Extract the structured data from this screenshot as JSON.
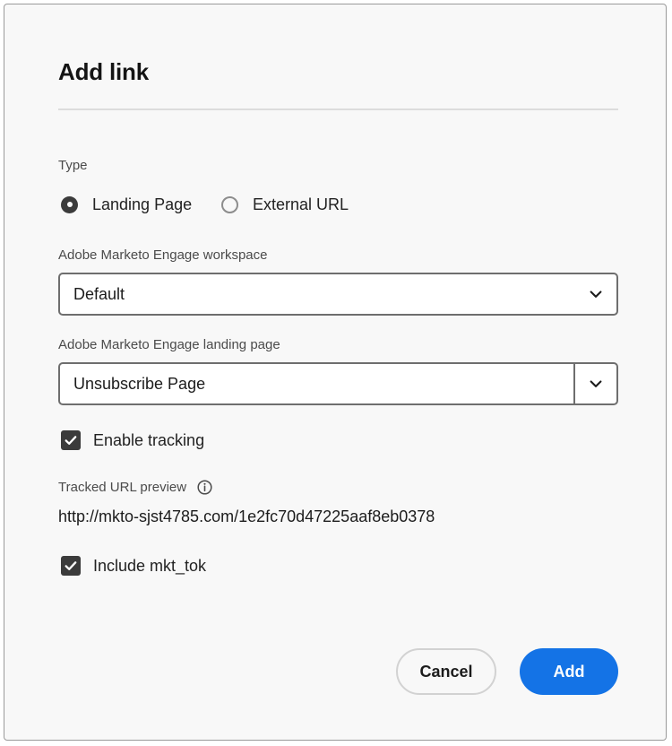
{
  "dialog": {
    "title": "Add link"
  },
  "type_field": {
    "label": "Type",
    "options": [
      {
        "label": "Landing Page",
        "selected": true
      },
      {
        "label": "External URL",
        "selected": false
      }
    ]
  },
  "workspace_field": {
    "label": "Adobe Marketo Engage workspace",
    "value": "Default",
    "chevron_icon": "chevron-down-icon"
  },
  "landing_page_field": {
    "label": "Adobe Marketo Engage landing page",
    "value": "Unsubscribe Page",
    "chevron_icon": "chevron-down-icon"
  },
  "enable_tracking": {
    "label": "Enable tracking",
    "checked": true,
    "check_icon": "checkmark-icon"
  },
  "tracked_url_preview": {
    "label": "Tracked URL preview",
    "info_icon": "info-icon",
    "url": "http://mkto-sjst4785.com/1e2fc70d47225aaf8eb0378"
  },
  "include_mkt_tok": {
    "label": "Include mkt_tok",
    "checked": true,
    "check_icon": "checkmark-icon"
  },
  "footer": {
    "cancel_label": "Cancel",
    "add_label": "Add"
  },
  "colors": {
    "accent_blue": "#1473e6",
    "control_dark": "#3b3b3b",
    "border_gray": "#6e6e6e",
    "dialog_background": "#f8f8f8",
    "divider": "#dcdcdc"
  }
}
